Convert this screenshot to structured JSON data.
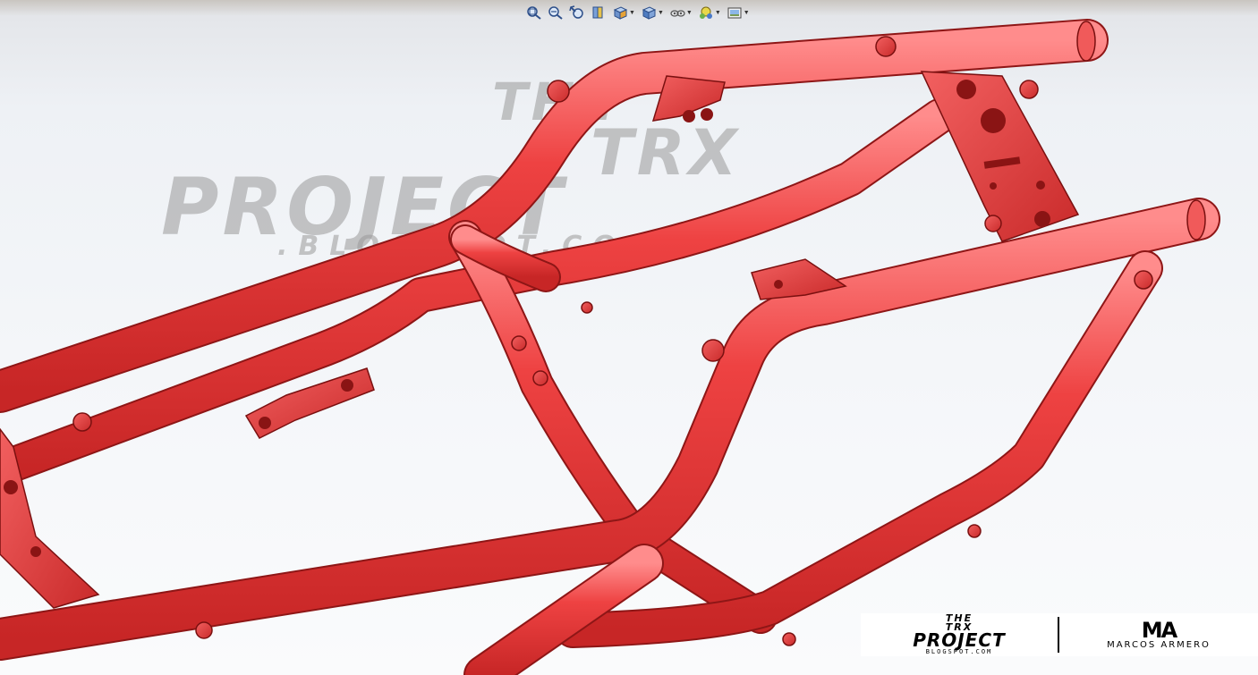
{
  "toolbar": {
    "buttons": [
      {
        "icon": "zoom-to-fit-icon",
        "dropdown": false
      },
      {
        "icon": "zoom-to-area-icon",
        "dropdown": false
      },
      {
        "icon": "previous-view-icon",
        "dropdown": false
      },
      {
        "icon": "section-view-icon",
        "dropdown": false
      },
      {
        "icon": "view-orientation-icon",
        "dropdown": true
      },
      {
        "icon": "display-style-icon",
        "dropdown": true
      },
      {
        "icon": "hide-show-items-icon",
        "dropdown": true
      },
      {
        "icon": "edit-appearance-icon",
        "dropdown": true
      },
      {
        "icon": "apply-scene-icon",
        "dropdown": true
      }
    ]
  },
  "watermark": {
    "line1": "THE",
    "line2": "TRX",
    "line3": "PROJECT",
    "line4": ".BLOGSPOT.COM"
  },
  "branding": {
    "the": "THE",
    "trx": "TRX",
    "project": "PROJECT",
    "blog": "BLOGSPOT.COM",
    "mark": "MA",
    "name": "MARCOS ARMERO"
  },
  "colors": {
    "frame": "#e83a3a",
    "frame_dark": "#a51c1c",
    "frame_light": "#ff8080",
    "background_top": "#c9c5c0",
    "background_bottom": "#fafbfc"
  }
}
